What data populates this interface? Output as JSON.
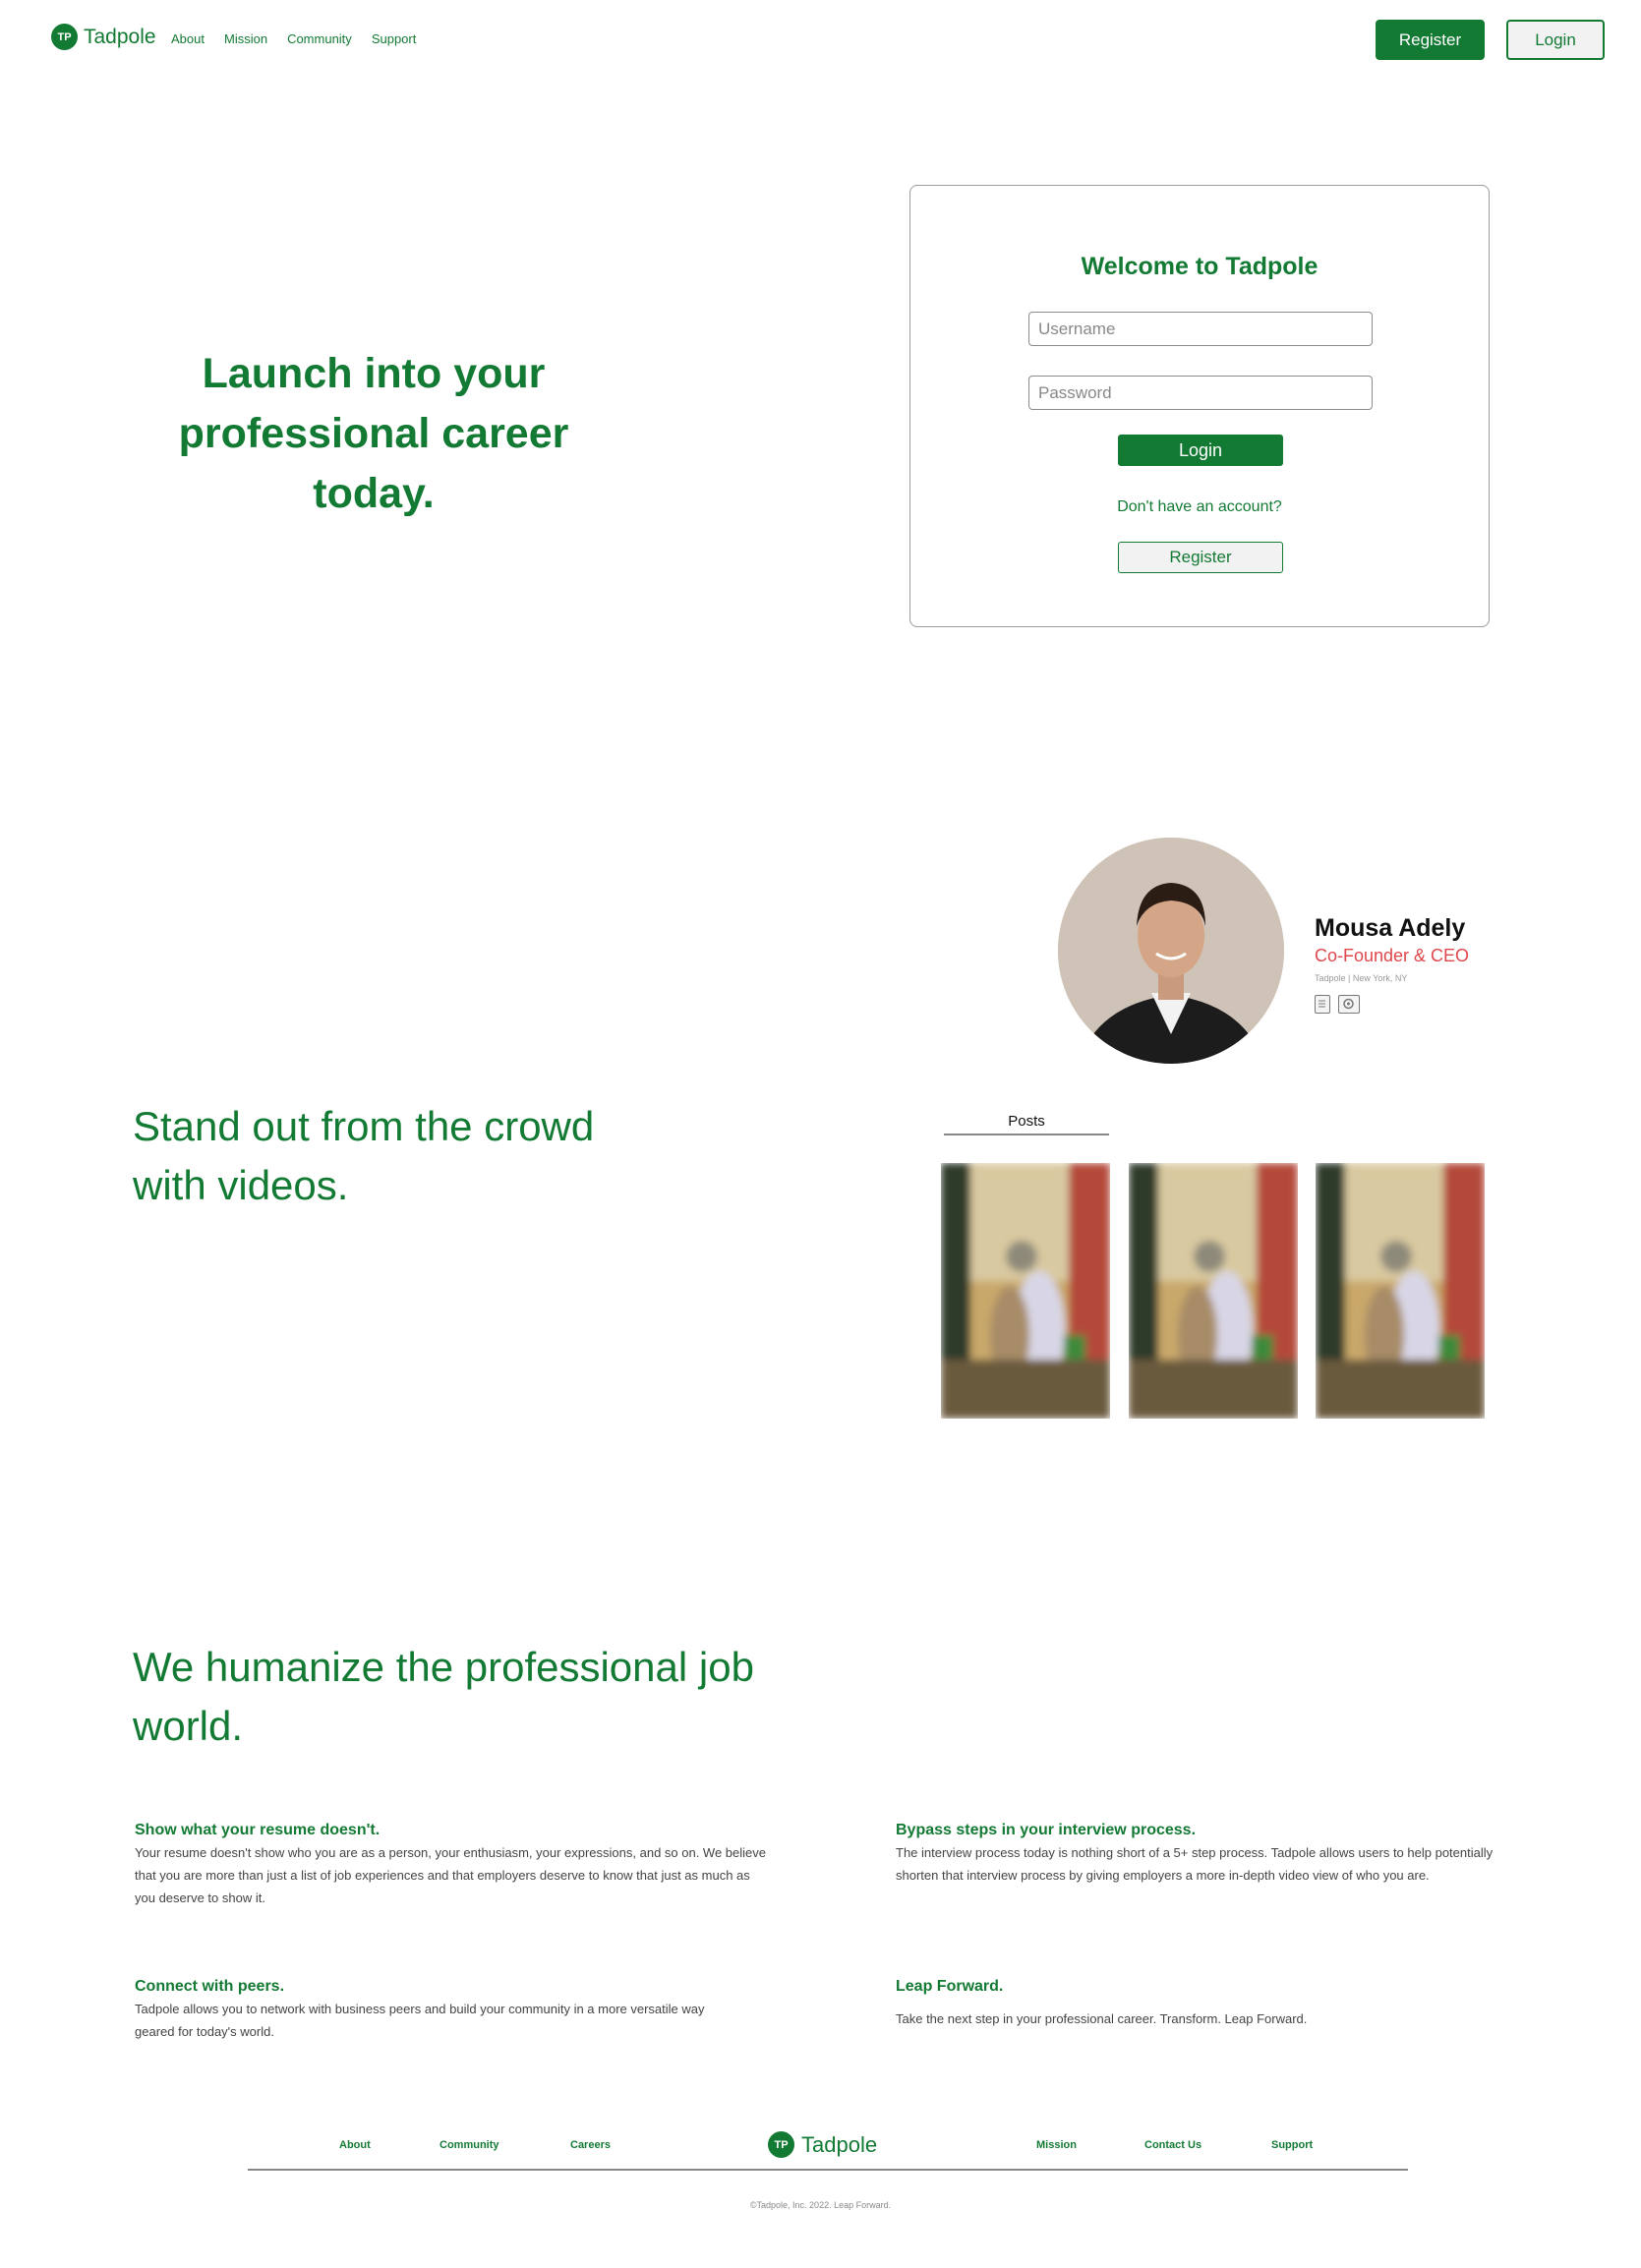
{
  "brand": {
    "name": "Tadpole",
    "badge": "TP",
    "color": "#137a34"
  },
  "nav": {
    "links": [
      "About",
      "Mission",
      "Community",
      "Support"
    ],
    "register": "Register",
    "login": "Login"
  },
  "hero": {
    "headline": "Launch into your professional career today."
  },
  "login_card": {
    "title": "Welcome to Tadpole",
    "username_placeholder": "Username",
    "password_placeholder": "Password",
    "login_button": "Login",
    "no_account": "Don't have an account?",
    "register_button": "Register"
  },
  "videos": {
    "headline": "Stand out from the crowd with videos.",
    "profile": {
      "name": "Mousa Adely",
      "role": "Co-Founder & CEO",
      "location": "Tadpole | New York, NY",
      "icons": [
        "resume-icon",
        "video-reel-icon"
      ],
      "role_color": "#e0474c"
    },
    "posts_label": "Posts",
    "post_count": 3
  },
  "humanize": {
    "headline": "We humanize the professional job world.",
    "features": [
      {
        "title": "Show what your resume doesn't.",
        "text": "Your resume doesn't show who you are as a person, your enthusiasm, your expressions, and so on. We believe that you are more than just a list of job experiences and that employers deserve to know that just as much as you deserve to show it."
      },
      {
        "title": "Bypass steps in your interview process.",
        "text": "The interview process today is nothing short of a 5+ step process. Tadpole allows users to help potentially shorten that interview process by giving employers a more in-depth video view of who you are."
      },
      {
        "title": "Connect with peers.",
        "text": "Tadpole allows you to network with business peers and build your community in a more versatile way geared for today's world."
      },
      {
        "title": "Leap Forward.",
        "text": "Take the next step in your professional career. Transform. Leap Forward."
      }
    ]
  },
  "footer": {
    "left_links": [
      "About",
      "Community",
      "Careers"
    ],
    "right_links": [
      "Mission",
      "Contact Us",
      "Support"
    ],
    "copyright": "©Tadpole, Inc. 2022. Leap Forward."
  }
}
